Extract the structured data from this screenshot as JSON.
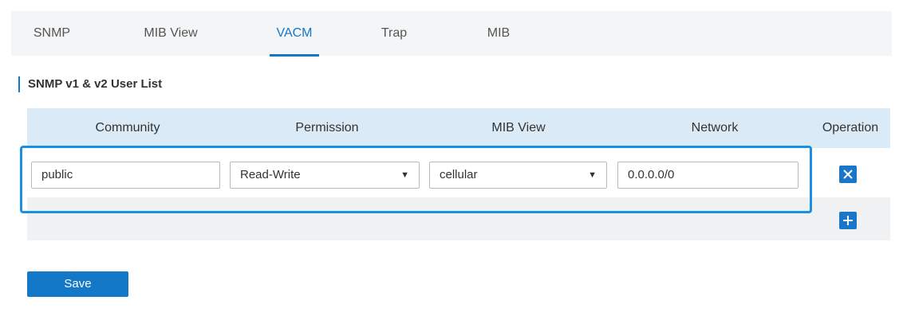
{
  "tabs": [
    {
      "label": "SNMP"
    },
    {
      "label": "MIB View"
    },
    {
      "label": "VACM"
    },
    {
      "label": "Trap"
    },
    {
      "label": "MIB"
    }
  ],
  "active_tab": "VACM",
  "section": {
    "title": "SNMP v1 & v2 User List"
  },
  "table": {
    "headers": [
      "Community",
      "Permission",
      "MIB View",
      "Network",
      "Operation"
    ],
    "rows": [
      {
        "community": "public",
        "permission": "Read-Write",
        "mib_view": "cellular",
        "network": "0.0.0.0/0"
      }
    ]
  },
  "icons": {
    "delete": "close-icon",
    "add": "plus-icon",
    "dropdown": "triangle-down-icon"
  },
  "dropdown_arrow": "▼",
  "save_label": "Save",
  "colors": {
    "accent": "#1478c8",
    "highlight": "#1a8fe3",
    "header_bg": "#dbeaf7"
  }
}
